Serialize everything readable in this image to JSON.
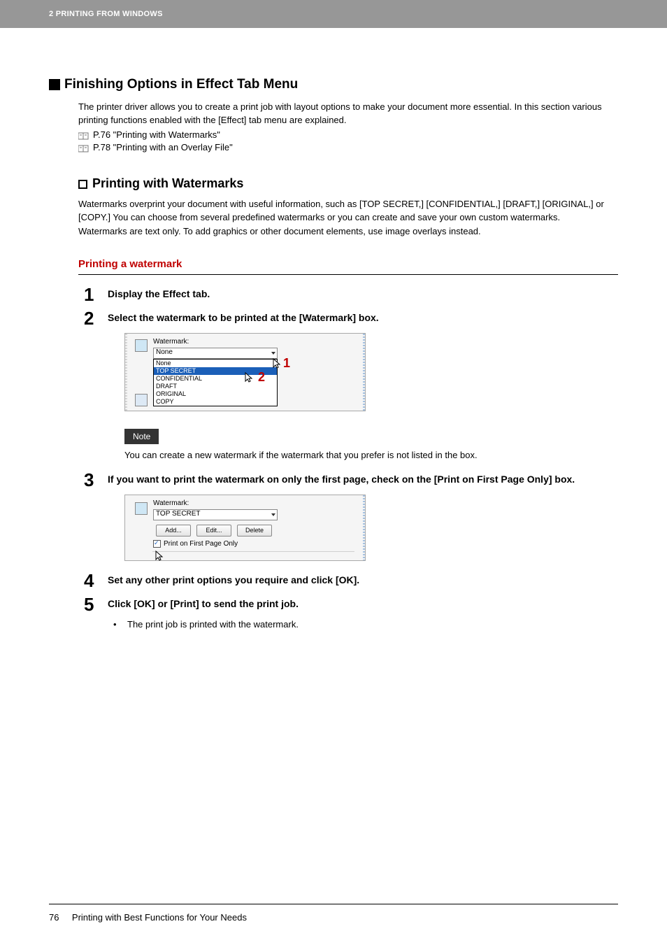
{
  "header": "2 PRINTING FROM WINDOWS",
  "h1": "Finishing Options in Effect Tab Menu",
  "intro1": "The printer driver allows you to create a print job with layout options to make your document more essential.  In this section various printing functions enabled with the [Effect] tab menu are explained.",
  "ref1": "P.76 \"Printing with Watermarks\"",
  "ref2": "P.78 \"Printing with an Overlay File\"",
  "h2": "Printing with Watermarks",
  "p1": "Watermarks overprint your document with useful information, such as [TOP SECRET,] [CONFIDENTIAL,] [DRAFT,] [ORIGINAL,] or [COPY.]  You can choose from several predefined watermarks or you can create and save your own custom watermarks.",
  "p2": "Watermarks are text only. To add graphics or other document elements, use image overlays instead.",
  "h3": "Printing a watermark",
  "steps": {
    "s1": {
      "num": "1",
      "text": "Display the Effect tab."
    },
    "s2": {
      "num": "2",
      "text": "Select the watermark to be printed at the [Watermark] box."
    },
    "s3": {
      "num": "3",
      "text": "If you want to print the watermark on only the first page, check on the [Print on First Page Only] box."
    },
    "s4": {
      "num": "4",
      "text": "Set any other print options you require and click [OK]."
    },
    "s5": {
      "num": "5",
      "text": "Click [OK] or [Print] to send the print job."
    }
  },
  "bullet": "The print job is printed with the watermark.",
  "note_label": "Note",
  "note_text": "You can create a new watermark if the watermark that you prefer is not listed in the box.",
  "ss1": {
    "label": "Watermark:",
    "selected": "None",
    "options": [
      "None",
      "TOP SECRET",
      "CONFIDENTIAL",
      "DRAFT",
      "ORIGINAL",
      "COPY"
    ],
    "marker1": "1",
    "marker2": "2"
  },
  "ss2": {
    "label": "Watermark:",
    "selected": "TOP SECRET",
    "add": "Add...",
    "edit": "Edit...",
    "delete": "Delete",
    "checkbox": "Print on First Page Only"
  },
  "footer": {
    "page": "76",
    "title": "Printing with Best Functions for Your Needs"
  }
}
